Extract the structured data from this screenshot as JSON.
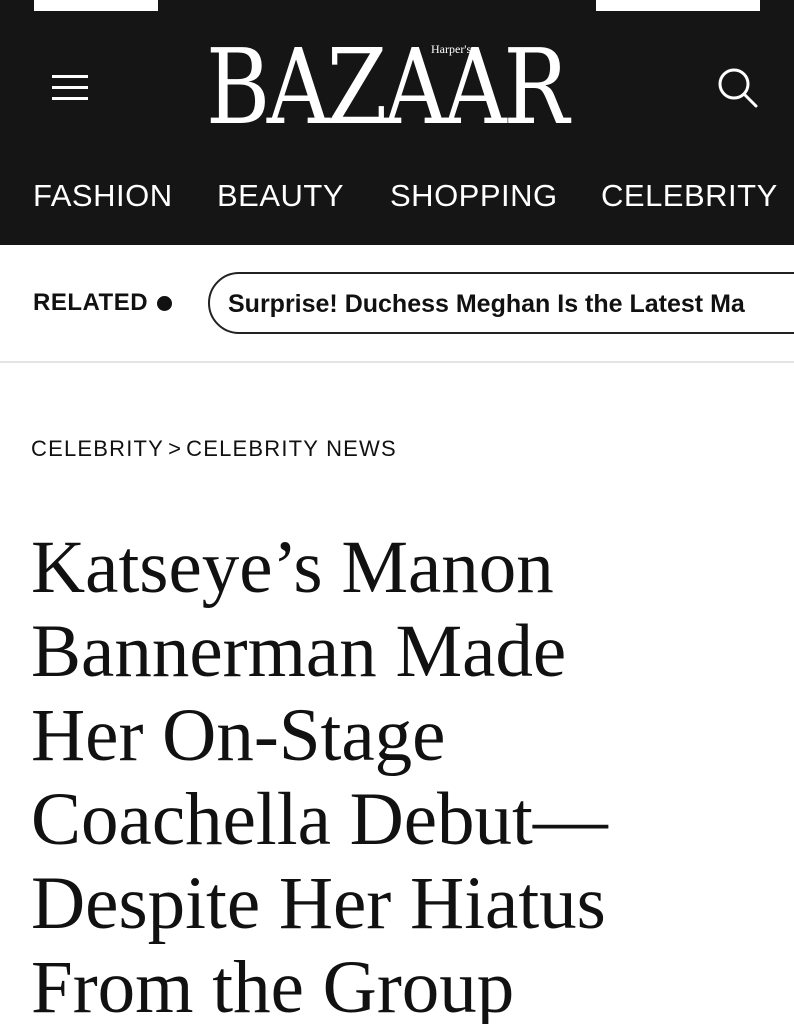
{
  "header": {
    "logo_main": "BAZAAR",
    "logo_sup": "Harper's",
    "nav": [
      "FASHION",
      "BEAUTY",
      "SHOPPING",
      "CELEBRITY"
    ]
  },
  "related": {
    "label": "RELATED",
    "headline": "Surprise! Duchess Meghan Is the Latest Ma"
  },
  "breadcrumb": {
    "section": "CELEBRITY",
    "separator": ">",
    "subsection": "CELEBRITY NEWS"
  },
  "article": {
    "headline_lines": [
      "Katseye’s Manon",
      "Bannerman Made",
      "Her On-Stage",
      "Coachella Debut—",
      "Despite Her Hiatus",
      "From the Group"
    ]
  },
  "colors": {
    "header_bg": "#151515",
    "text": "#111111",
    "divider": "#e4e4e4"
  },
  "icons": [
    "hamburger-menu-icon",
    "search-icon",
    "bullet-dot-icon"
  ]
}
